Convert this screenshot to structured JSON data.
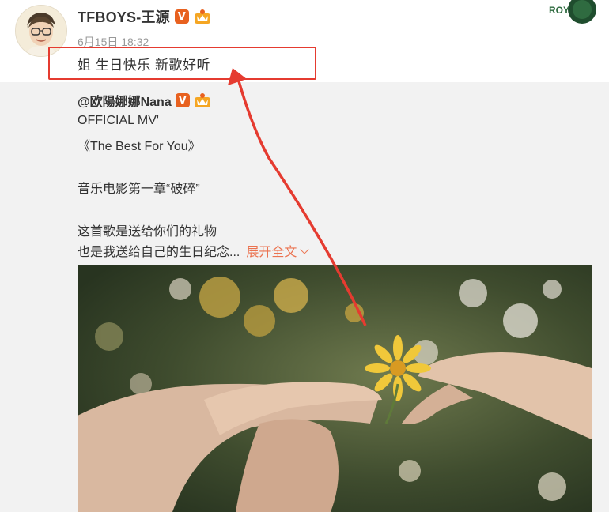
{
  "post": {
    "author_name": "TFBOYS-王源",
    "verified_badge": "V",
    "time": "6月15日 18:32",
    "text": "姐 生日快乐 新歌好听",
    "corner_logo_text": "ROY"
  },
  "repost": {
    "author": "@欧陽娜娜Nana",
    "verified_badge": "V",
    "lines": [
      "OFFICIAL MV'",
      "《The Best For You》",
      "音乐电影第一章“破碎”",
      "这首歌是送给你们的礼物",
      "也是我送给自己的生日纪念..."
    ],
    "expand_label": "展开全文"
  },
  "colors": {
    "highlight": "#e53b30",
    "expand_link": "#eb7350",
    "badge": "#e8611f"
  },
  "icons": [
    "avatar",
    "verified-badge-icon",
    "crown-icon",
    "chevron-down-icon",
    "arrow-annotation"
  ]
}
